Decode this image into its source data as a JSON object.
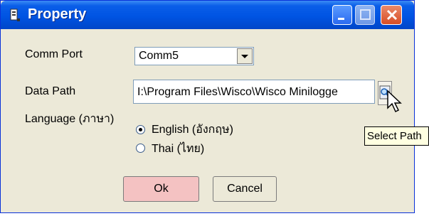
{
  "window": {
    "title": "Property",
    "buttons": {
      "minimize": "minimize-icon",
      "maximize": "maximize-icon",
      "close": "close-icon"
    }
  },
  "form": {
    "comm_port": {
      "label": "Comm Port",
      "value": "Comm5"
    },
    "data_path": {
      "label": "Data Path",
      "value": "I:\\Program Files\\Wisco\\Wisco Minilogge"
    },
    "language": {
      "label": "Language (ภาษา)",
      "options": [
        {
          "label": "English (อังกฤษ)",
          "selected": true
        },
        {
          "label": "Thai (ไทย)",
          "selected": false
        }
      ]
    }
  },
  "actions": {
    "ok": "Ok",
    "cancel": "Cancel"
  },
  "tooltip": "Select Path",
  "colors": {
    "titlebar": "#0054e3",
    "ok_button": "#f4c2c2",
    "window_bg": "#ece9d8"
  }
}
